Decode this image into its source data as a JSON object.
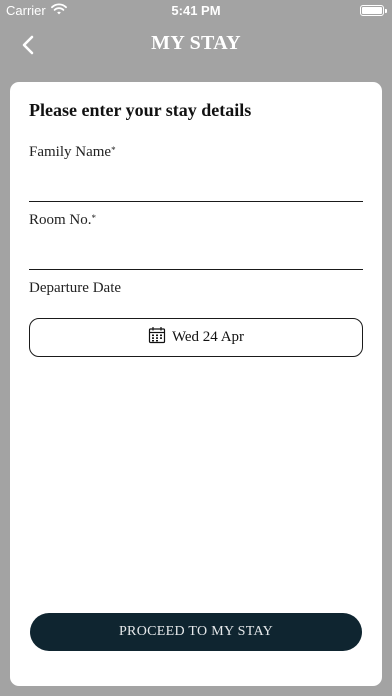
{
  "status_bar": {
    "carrier": "Carrier",
    "time": "5:41 PM",
    "icons": [
      "wifi-icon",
      "battery-icon"
    ],
    "battery_level": 1.0
  },
  "header": {
    "title": "MY STAY",
    "back_icon": "chevron-left-icon"
  },
  "form": {
    "heading": "Please enter your stay details",
    "family_name": {
      "label": "Family Name",
      "required_mark": "*",
      "value": ""
    },
    "room_no": {
      "label": "Room No.",
      "required_mark": "*",
      "value": ""
    },
    "departure_date": {
      "label": "Departure Date",
      "value": "Wed 24 Apr",
      "icon": "calendar-icon"
    },
    "proceed_label": "PROCEED TO MY STAY"
  },
  "colors": {
    "background": "#a3a3a3",
    "card": "#ffffff",
    "primary_button": "#0f2530",
    "primary_button_text": "#e6e9eb"
  }
}
